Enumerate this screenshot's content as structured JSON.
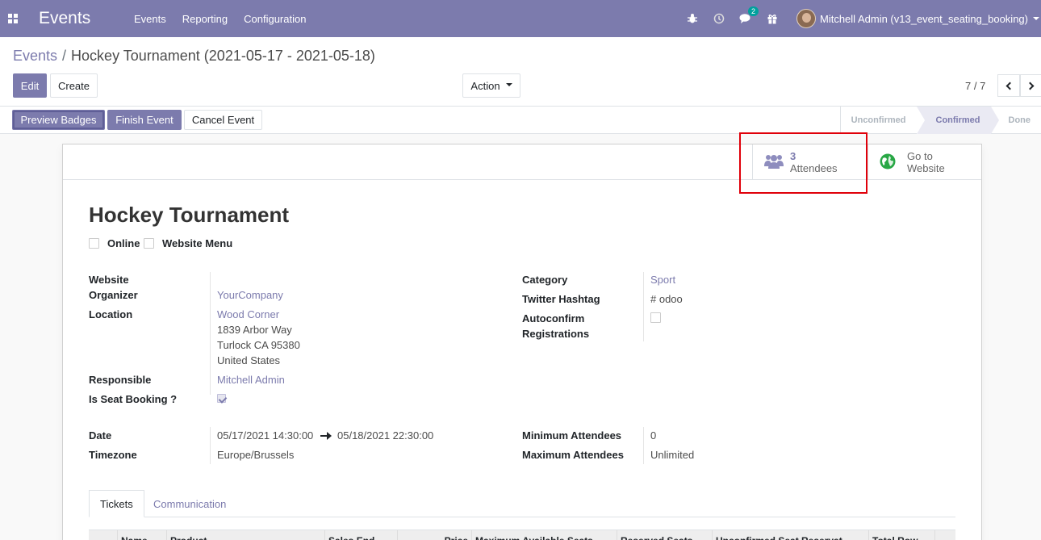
{
  "navbar": {
    "app_name": "Events",
    "menu": [
      "Events",
      "Reporting",
      "Configuration"
    ],
    "chat_badge": "2",
    "user_name": "Mitchell Admin (v13_event_seating_booking)"
  },
  "breadcrumb": {
    "parent": "Events",
    "separator": "/",
    "current": "Hockey Tournament (2021-05-17 - 2021-05-18)"
  },
  "toolbar": {
    "edit_label": "Edit",
    "create_label": "Create",
    "action_label": "Action",
    "pager_value": "7 / 7"
  },
  "statusbar": {
    "preview_badges_label": "Preview Badges",
    "finish_event_label": "Finish Event",
    "cancel_event_label": "Cancel Event",
    "stages": [
      "Unconfirmed",
      "Confirmed",
      "Done"
    ],
    "active_stage": "Confirmed"
  },
  "button_box": {
    "attendees_count": "3",
    "attendees_label": "Attendees",
    "website_line1": "Go to",
    "website_line2": "Website"
  },
  "form": {
    "title": "Hockey Tournament",
    "online_label": "Online",
    "website_menu_label": "Website Menu",
    "labels": {
      "website_organizer_1": "Website",
      "website_organizer_2": "Organizer",
      "location": "Location",
      "responsible": "Responsible",
      "seat_booking": "Is Seat Booking ?",
      "category": "Category",
      "twitter_hashtag": "Twitter Hashtag",
      "autoconfirm_1": "Autoconfirm",
      "autoconfirm_2": "Registrations",
      "date": "Date",
      "timezone": "Timezone",
      "min_attendees": "Minimum Attendees",
      "max_attendees": "Maximum Attendees"
    },
    "values": {
      "organizer": "YourCompany",
      "location_name": "Wood Corner",
      "address_line1": "1839 Arbor Way",
      "address_line2": "Turlock CA 95380",
      "address_line3": "United States",
      "responsible": "Mitchell Admin",
      "category": "Sport",
      "twitter_hashtag": "# odoo",
      "date_begin": "05/17/2021 14:30:00",
      "date_end": "05/18/2021 22:30:00",
      "timezone": "Europe/Brussels",
      "min_attendees": "0",
      "max_attendees": "Unlimited"
    }
  },
  "tabs": [
    "Tickets",
    "Communication"
  ],
  "tickets_table": {
    "columns": [
      "Name",
      "Product",
      "Sales End",
      "Price",
      "Maximum Available Seats",
      "Reserved Seats",
      "Unconfirmed Seat Reservat",
      "Total Row"
    ]
  },
  "colors": {
    "brand": "#7c7bad",
    "highlight": "#e0000a",
    "website_icon": "#28a745"
  }
}
